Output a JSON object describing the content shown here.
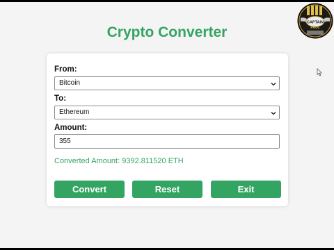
{
  "app": {
    "title": "Crypto Converter"
  },
  "form": {
    "from_label": "From:",
    "from_value": "Bitcoin",
    "to_label": "To:",
    "to_value": "Ethereum",
    "amount_label": "Amount:",
    "amount_value": "355",
    "result_text": "Converted Amount: 9392.811520 ETH"
  },
  "buttons": {
    "convert": "Convert",
    "reset": "Reset",
    "exit": "Exit"
  },
  "logo": {
    "text_line1": "CAPTAIN",
    "text_line2": "PAUL"
  },
  "colors": {
    "accent": "#34a462",
    "page_background": "#f4f4f4",
    "card_background": "#ffffff"
  },
  "icons": {
    "select_arrow": "chevron-down-icon",
    "cursor": "mouse-pointer-icon",
    "logo": "captain-paul-logo"
  }
}
